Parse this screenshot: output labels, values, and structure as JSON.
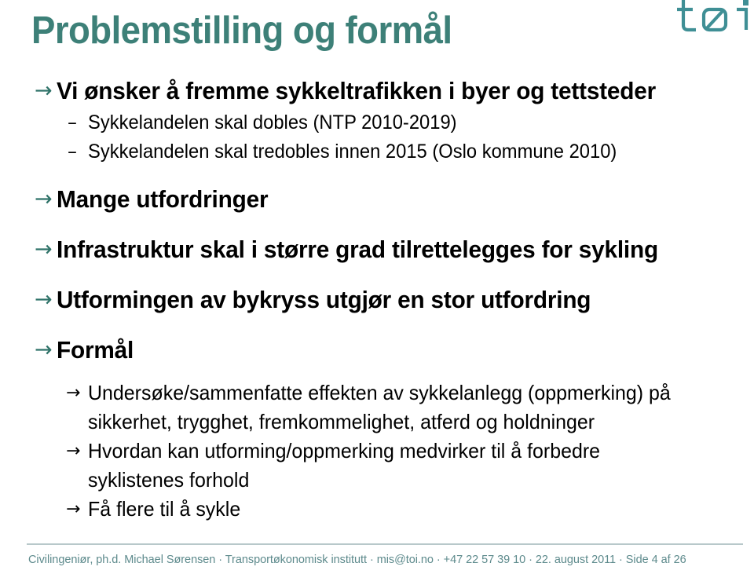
{
  "slide": {
    "title": "Problemstilling og formål",
    "title_color": "#3d8078",
    "accent_color": "#2e7268",
    "background_color": "#ffffff"
  },
  "logo": {
    "name": "toi-logo",
    "text": "tøi",
    "color": "#3f8f95"
  },
  "markers": {
    "level1": "→",
    "level2": "–",
    "level3": "→"
  },
  "outline": [
    {
      "level": 1,
      "text": "Vi ønsker å fremme sykkeltrafikken i byer og tettsteder"
    },
    {
      "level": 2,
      "text": "Sykkelandelen skal dobles (NTP 2010-2019)"
    },
    {
      "level": 2,
      "text": "Sykkelandelen skal tredobles innen 2015 (Oslo kommune 2010)"
    },
    {
      "level": 1,
      "text": "Mange utfordringer"
    },
    {
      "level": 1,
      "text": "Infrastruktur skal i større grad tilrettelegges for sykling"
    },
    {
      "level": 1,
      "text": "Utformingen av bykryss utgjør en stor utfordring"
    },
    {
      "level": 1,
      "text": "Formål"
    },
    {
      "level": 3,
      "text": "Undersøke/sammenfatte effekten av sykkelanlegg (oppmerking) på sikkerhet, trygghet, fremkommelighet, atferd og holdninger"
    },
    {
      "level": 3,
      "text": "Hvordan kan utforming/oppmerking medvirker til å forbedre syklistenes forhold"
    },
    {
      "level": 3,
      "text": "Få flere til å sykle"
    }
  ],
  "footer": {
    "text": "Civilingeniør, ph.d. Michael Sørensen · Transportøkonomisk institutt · mis@toi.no · +47 22 57 39 10 · 22. august 2011 · Side 4 af 26",
    "color": "#5d8a8c",
    "author": "Civilingeniør, ph.d. Michael Sørensen",
    "institute": "Transportøkonomisk institutt",
    "email": "mis@toi.no",
    "phone": "+47 22 57 39 10",
    "date": "22. august 2011",
    "page": "Side 4 af 26"
  }
}
